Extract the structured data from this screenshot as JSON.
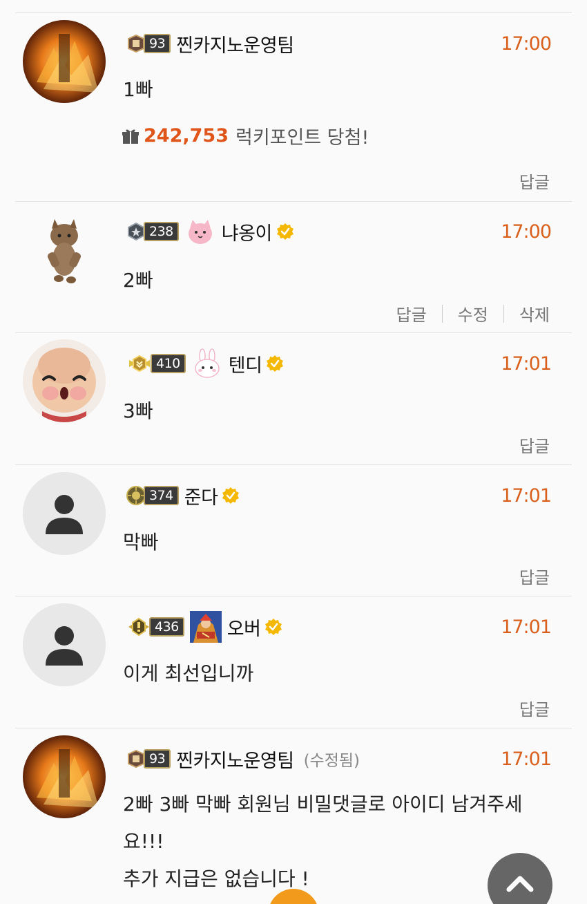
{
  "comments": [
    {
      "level": "93",
      "nickname": "찐카지노운영팀",
      "time": "17:00",
      "text": "1빠",
      "lucky_amount": "242,753",
      "lucky_text": "럭키포인트 당첨!",
      "reply_label": "답글"
    },
    {
      "level": "238",
      "nickname": "냐옹이",
      "time": "17:00",
      "text": "2빠",
      "reply_label": "답글",
      "edit_label": "수정",
      "delete_label": "삭제"
    },
    {
      "level": "410",
      "nickname": "텐디",
      "time": "17:01",
      "text": "3빠",
      "reply_label": "답글"
    },
    {
      "level": "374",
      "nickname": "준다",
      "time": "17:01",
      "text": "막빠",
      "reply_label": "답글"
    },
    {
      "level": "436",
      "nickname": "오버",
      "time": "17:01",
      "text": "이게 최선입니까",
      "reply_label": "답글"
    },
    {
      "level": "93",
      "nickname": "찐카지노운영팀",
      "edited_label": "(수정됨)",
      "time": "17:01",
      "text_line1": "2빠 3빠 막빠 회원님 비밀댓글로 아이디 남겨주세",
      "text_line2": "요!!!",
      "text_line3": "추가 지급은 없습니다 !"
    }
  ],
  "colors": {
    "time": "#d9601c",
    "lucky_amount": "#e0551a",
    "verified": "#f5b800"
  }
}
